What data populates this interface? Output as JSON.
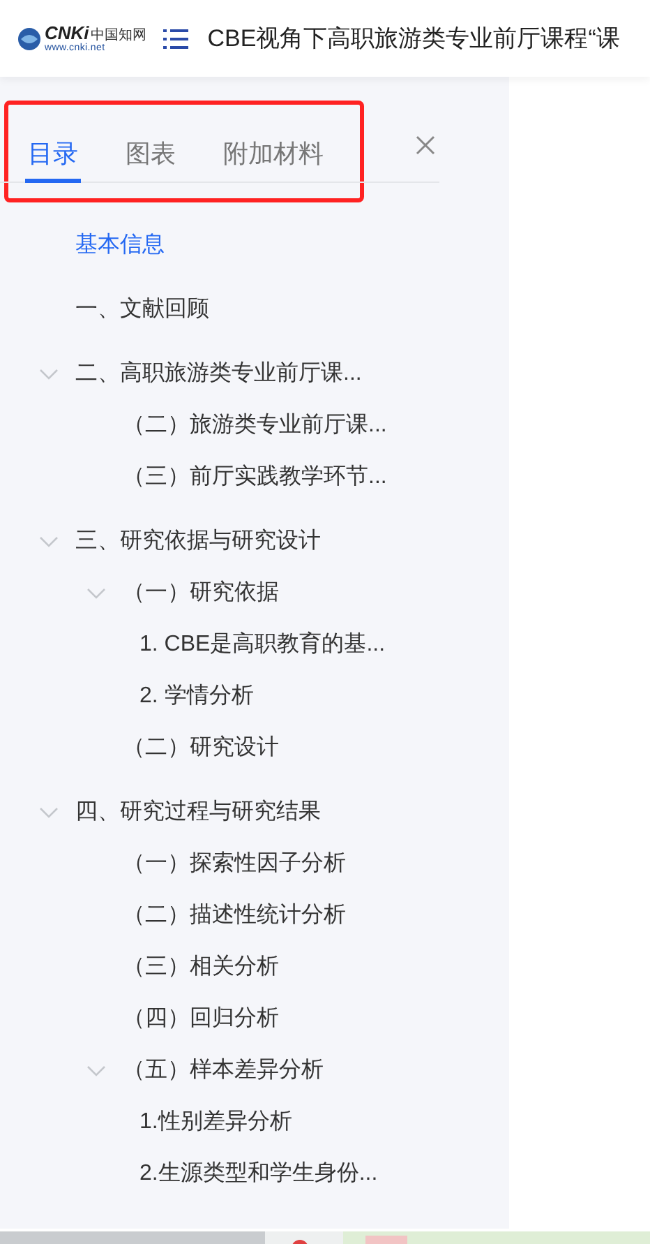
{
  "header": {
    "logo": {
      "brand": "CNKi",
      "name": "中国知网",
      "url": "www.cnki.net"
    },
    "title": "CBE视角下高职旅游类专业前厅课程“课"
  },
  "panel": {
    "highlighted": true,
    "tabs": [
      {
        "label": "目录",
        "selected": true
      },
      {
        "label": "图表",
        "selected": false
      },
      {
        "label": "附加材料",
        "selected": false
      }
    ]
  },
  "outline": [
    {
      "label": "基本信息",
      "selected": true
    },
    {
      "label": "一、文献回顾",
      "selected": false
    },
    {
      "label": "二、高职旅游类专业前厅课...",
      "selected": false,
      "expanded": true,
      "children": [
        {
          "label": "（二）旅游类专业前厅课...",
          "selected": false
        },
        {
          "label": "（三）前厅实践教学环节...",
          "selected": false
        }
      ]
    },
    {
      "label": "三、研究依据与研究设计",
      "selected": false,
      "expanded": true,
      "children": [
        {
          "label": "（一）研究依据",
          "selected": false,
          "expanded": true,
          "children": [
            {
              "label": "1. CBE是高职教育的基...",
              "selected": false
            },
            {
              "label": "2. 学情分析",
              "selected": false
            }
          ]
        },
        {
          "label": "（二）研究设计",
          "selected": false
        }
      ]
    },
    {
      "label": "四、研究过程与研究结果",
      "selected": false,
      "expanded": true,
      "children": [
        {
          "label": "（一）探索性因子分析",
          "selected": false
        },
        {
          "label": "（二）描述性统计分析",
          "selected": false
        },
        {
          "label": "（三）相关分析",
          "selected": false
        },
        {
          "label": "（四）回归分析",
          "selected": false
        },
        {
          "label": "（五）样本差异分析",
          "selected": false,
          "expanded": true,
          "children": [
            {
              "label": "1.性别差异分析",
              "selected": false
            },
            {
              "label": "2.生源类型和学生身份...",
              "selected": false
            }
          ]
        }
      ]
    }
  ]
}
